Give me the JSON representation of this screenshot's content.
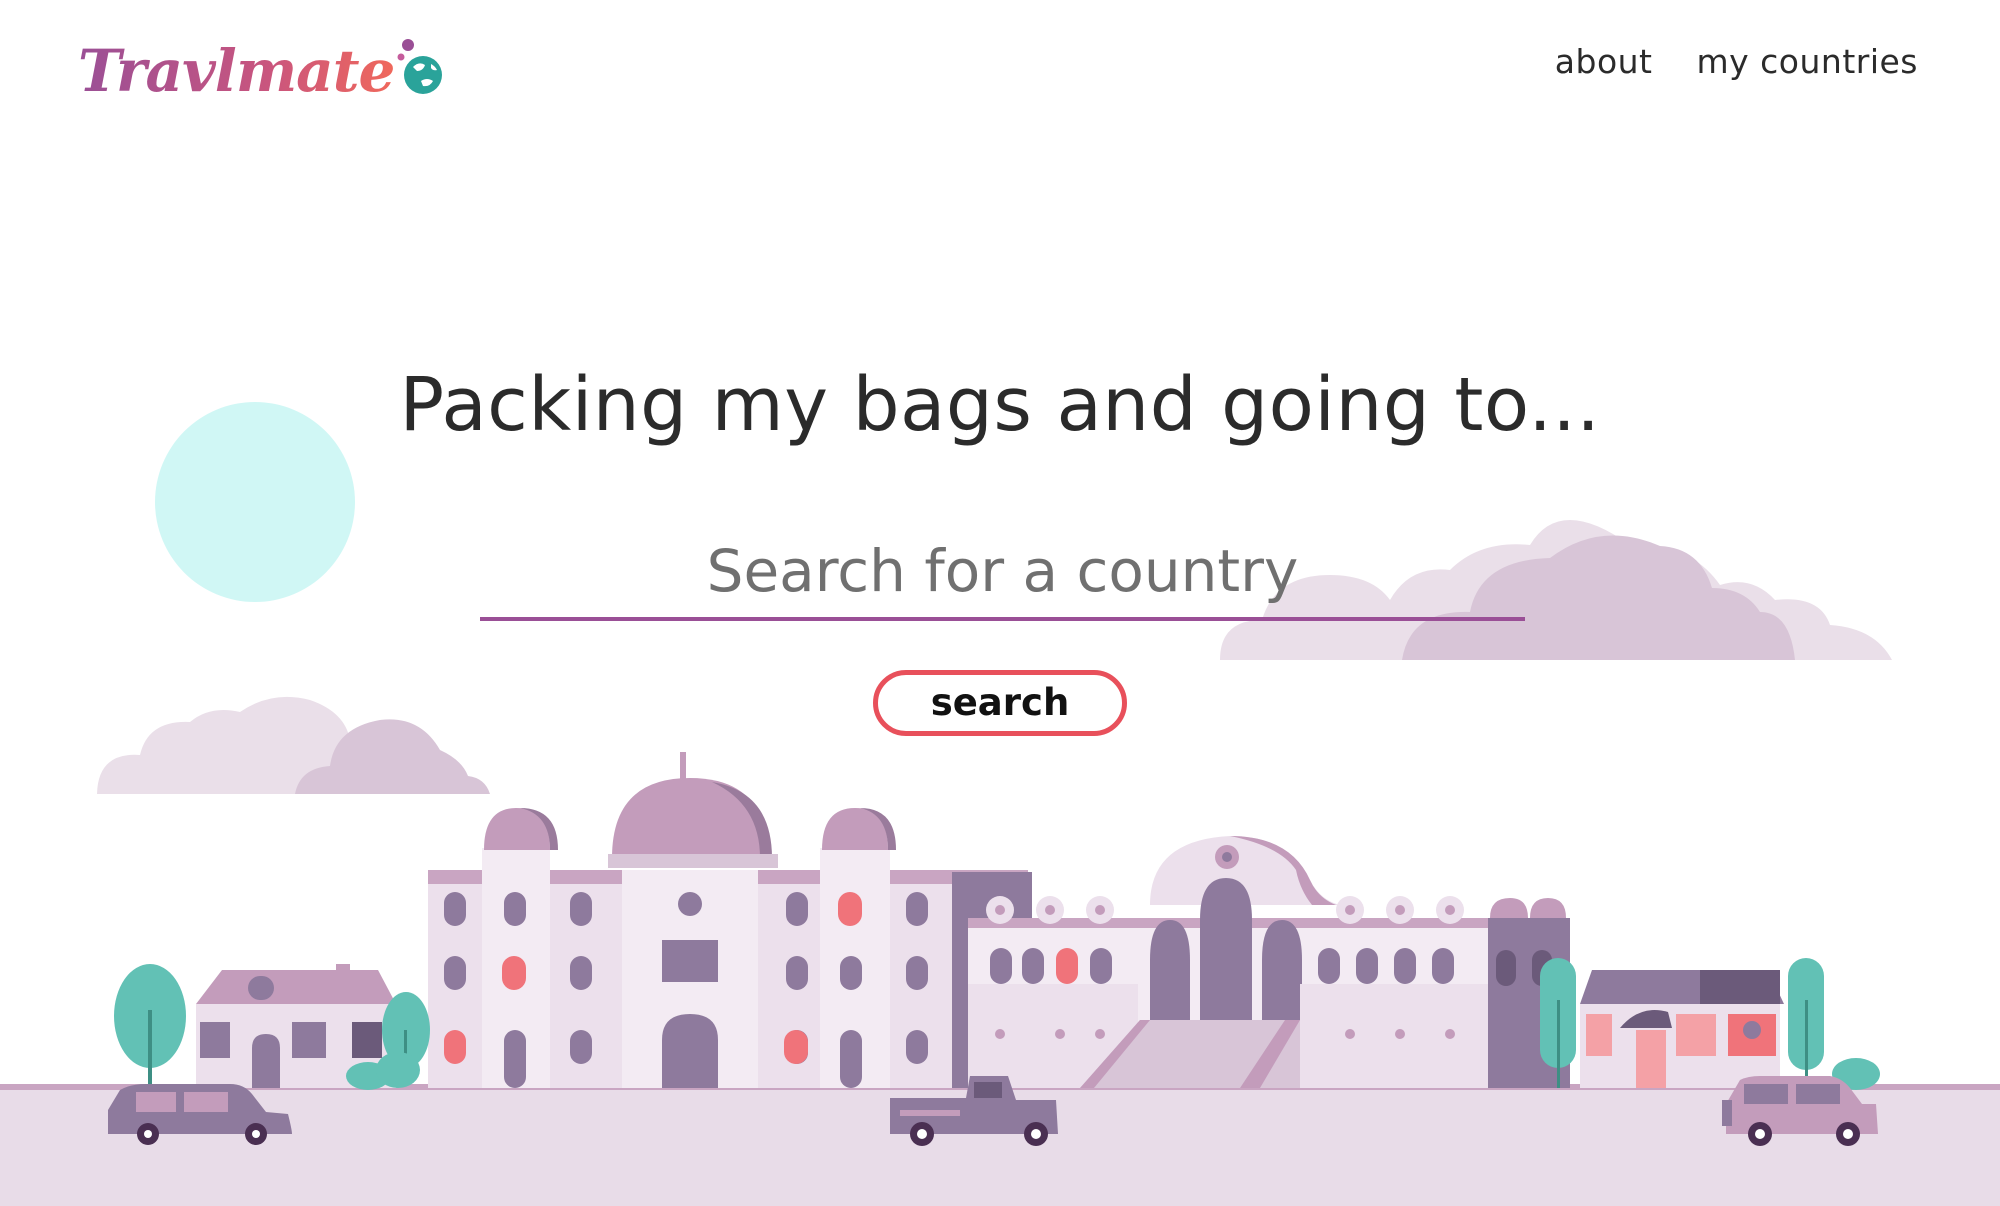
{
  "brand": {
    "name": "Travlmate",
    "colors": {
      "primary": "#9a4f96",
      "accent": "#e8505b",
      "globe": "#2aa39a"
    }
  },
  "nav": {
    "items": [
      {
        "label": "about"
      },
      {
        "label": "my countries"
      }
    ]
  },
  "hero": {
    "headline": "Packing my bags and going to...",
    "search": {
      "placeholder": "Search for a country",
      "value": ""
    },
    "search_button_label": "search"
  },
  "illustration": {
    "theme": "city skyline with palace, houses, trees, cars and clouds"
  }
}
